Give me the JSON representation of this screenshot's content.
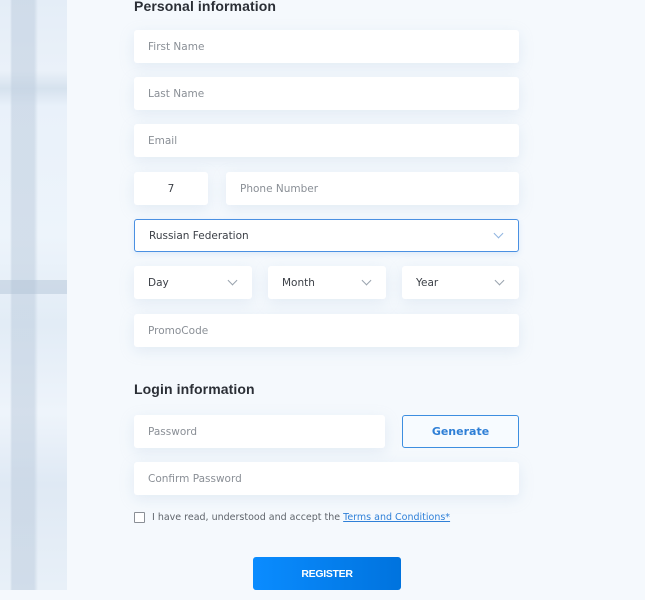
{
  "personal": {
    "title": "Personal information",
    "first_name_placeholder": "First Name",
    "last_name_placeholder": "Last Name",
    "email_placeholder": "Email",
    "phone_code": "7",
    "phone_placeholder": "Phone Number",
    "country": "Russian Federation",
    "day": "Day",
    "month": "Month",
    "year": "Year",
    "promo_placeholder": "PromoCode"
  },
  "login": {
    "title": "Login information",
    "password_placeholder": "Password",
    "generate_label": "Generate",
    "confirm_placeholder": "Confirm Password"
  },
  "agreement": {
    "text": "I have read, understood and accept the",
    "link": "Terms and Conditions*",
    "checked": false
  },
  "register_label": "REGISTER",
  "colors": {
    "accent": "#0a8cff",
    "link": "#2f80d8",
    "background": "#f5f9fd"
  }
}
